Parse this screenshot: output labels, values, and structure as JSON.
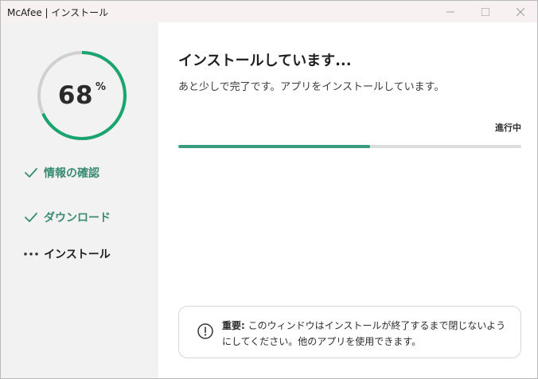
{
  "window": {
    "title": "McAfee | インストール"
  },
  "sidebar": {
    "progress": {
      "value": 68,
      "display": "68",
      "unit": "%"
    },
    "steps": [
      {
        "label": "情報の確認",
        "state": "done",
        "icon": "check-icon"
      },
      {
        "label": "ダウンロード",
        "state": "done",
        "icon": "check-icon"
      },
      {
        "label": "インストール",
        "state": "active",
        "icon": "ellipsis-icon"
      }
    ]
  },
  "main": {
    "heading": "インストールしています...",
    "subtext": "あと少しで完了です。アプリをインストールしています。",
    "status": "進行中",
    "progress_fraction": 0.56,
    "notice": {
      "prefix": "重要:",
      "text": " このウィンドウはインストールが終了するまで閉じないようにしてください。他のアプリを使用できます。"
    }
  },
  "colors": {
    "accent": "#1aa56e",
    "done_text": "#3a8a73",
    "bar": "#3a9a7d",
    "sidebar_bg": "#f2f2f2",
    "titlebar_bg": "#f7f1f2"
  }
}
